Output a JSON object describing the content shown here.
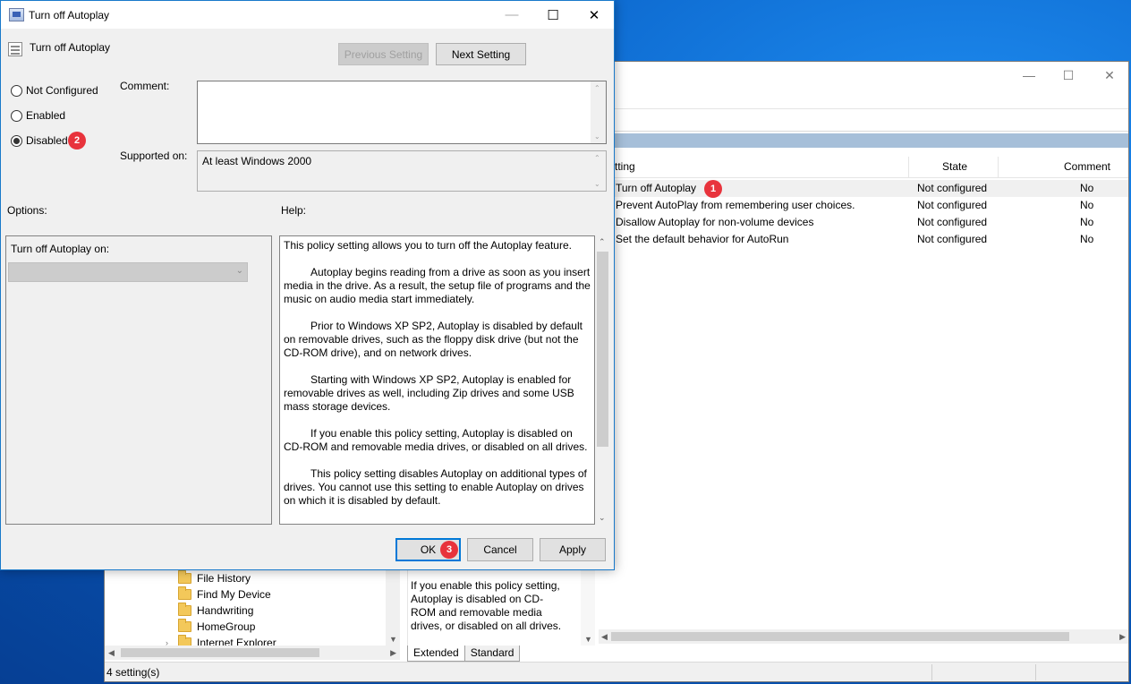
{
  "background_window": {
    "columns": {
      "setting": "tting",
      "state": "State",
      "comment": "Comment"
    },
    "rows": [
      {
        "setting": "Turn off Autoplay",
        "state": "Not configured",
        "comment": "No",
        "badge": "1"
      },
      {
        "setting": "Prevent AutoPlay from remembering user choices.",
        "state": "Not configured",
        "comment": "No"
      },
      {
        "setting": "Disallow Autoplay for non-volume devices",
        "state": "Not configured",
        "comment": "No"
      },
      {
        "setting": "Set the default behavior for AutoRun",
        "state": "Not configured",
        "comment": "No"
      }
    ],
    "tree_items": [
      "File History",
      "Find My Device",
      "Handwriting",
      "HomeGroup",
      "Internet Explorer"
    ],
    "description": "If you enable this policy setting, Autoplay is disabled on CD-ROM and removable media drives, or disabled on all drives.",
    "tabs": [
      "Extended",
      "Standard"
    ],
    "status": "4 setting(s)"
  },
  "dialog": {
    "title": "Turn off Autoplay",
    "policy_name": "Turn off Autoplay",
    "previous_setting": "Previous Setting",
    "next_setting": "Next Setting",
    "radios": [
      {
        "label": "Not Configured",
        "checked": false
      },
      {
        "label": "Enabled",
        "checked": false
      },
      {
        "label": "Disabled",
        "checked": true,
        "badge": "2"
      }
    ],
    "comment_label": "Comment:",
    "comment_value": "",
    "supported_label": "Supported on:",
    "supported_value": "At least Windows 2000",
    "options_label": "Options:",
    "help_label": "Help:",
    "options_field_label": "Turn off Autoplay on:",
    "options_field_value": "",
    "help_paragraphs": [
      "This policy setting allows you to turn off the Autoplay feature.",
      "Autoplay begins reading from a drive as soon as you insert media in the drive. As a result, the setup file of programs and the music on audio media start immediately.",
      "Prior to Windows XP SP2, Autoplay is disabled by default on removable drives, such as the floppy disk drive (but not the CD-ROM drive), and on network drives.",
      "Starting with Windows XP SP2, Autoplay is enabled for removable drives as well, including Zip drives and some USB mass storage devices.",
      "If you enable this policy setting, Autoplay is disabled on CD-ROM and removable media drives, or disabled on all drives.",
      "This policy setting disables Autoplay on additional types of drives. You cannot use this setting to enable Autoplay on drives on which it is disabled by default."
    ],
    "ok_label": "OK",
    "ok_badge": "3",
    "cancel_label": "Cancel",
    "apply_label": "Apply"
  },
  "colors": {
    "badge": "#e8333c",
    "accent": "#0078d7",
    "list_header_bar": "#a6bfd9"
  }
}
